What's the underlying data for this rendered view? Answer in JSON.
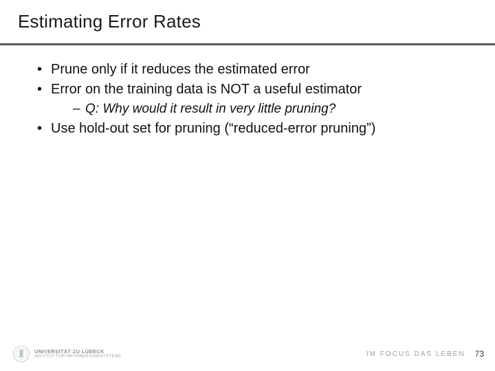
{
  "title": "Estimating Error Rates",
  "bullets": [
    {
      "text": "Prune only if it reduces the estimated error"
    },
    {
      "text": "Error on the training data is NOT a useful estimator",
      "sub": [
        "Q: Why would it result in very little pruning?"
      ]
    },
    {
      "text": "Use hold-out set for pruning (“reduced-error pruning”)"
    }
  ],
  "footer": {
    "university": "UNIVERSITÄT ZU LÜBECK",
    "institute": "INSTITUT FÜR INFORMATIONSSYSTEME",
    "motto": "IM FOCUS DAS LEBEN",
    "page": "73"
  }
}
